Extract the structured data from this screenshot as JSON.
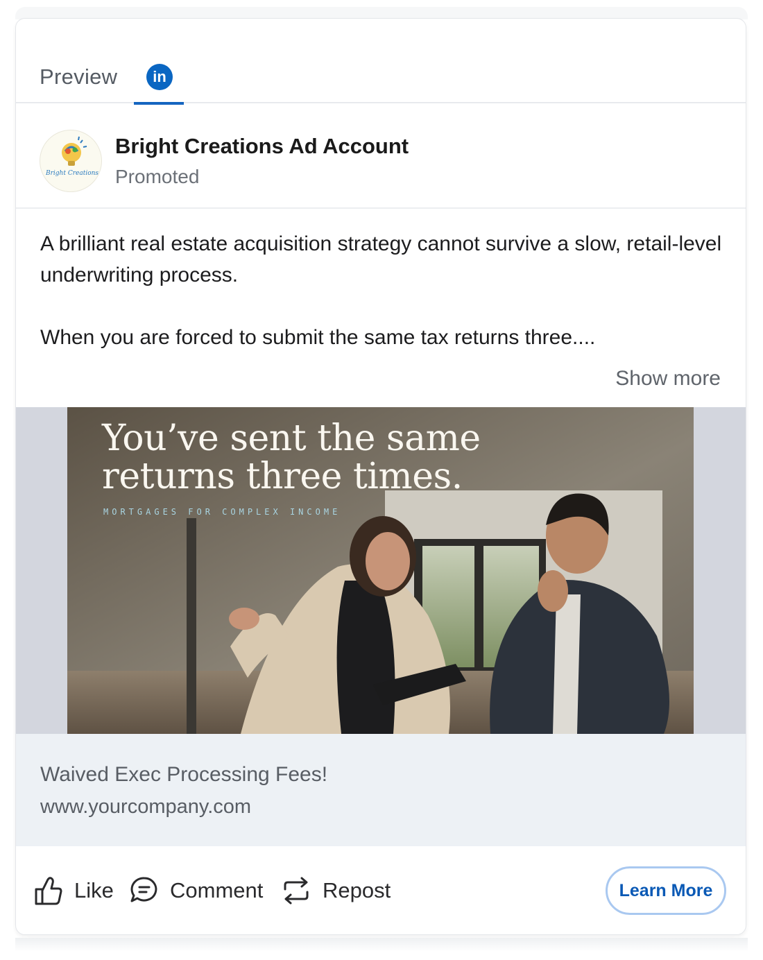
{
  "tabs": {
    "preview_label": "Preview",
    "active_network_icon": "linkedin-icon",
    "linkedin_badge": "in"
  },
  "post": {
    "account_name": "Bright Creations Ad Account",
    "sponsored_label": "Promoted",
    "avatar_logo_text": "Bright Creations",
    "body_paragraph_1": "A brilliant real estate acquisition strategy cannot survive a slow, retail-level underwriting process.",
    "body_paragraph_2": "When you are forced to submit the same tax returns three....",
    "show_more_label": "Show more"
  },
  "creative": {
    "headline": "You’ve sent the same\nreturns three times.",
    "tagline": "MORTGAGES FOR COMPLEX INCOME"
  },
  "link": {
    "title": "Waived Exec Processing Fees!",
    "url": "www.yourcompany.com"
  },
  "actions": {
    "like_label": "Like",
    "comment_label": "Comment",
    "repost_label": "Repost",
    "cta_label": "Learn More"
  },
  "colors": {
    "linkedin_blue": "#0a66c2",
    "tab_underline": "#1565c0",
    "cta_border": "#a9c8f0",
    "cta_text": "#0a59b5",
    "link_bar_bg": "#edf1f5"
  }
}
